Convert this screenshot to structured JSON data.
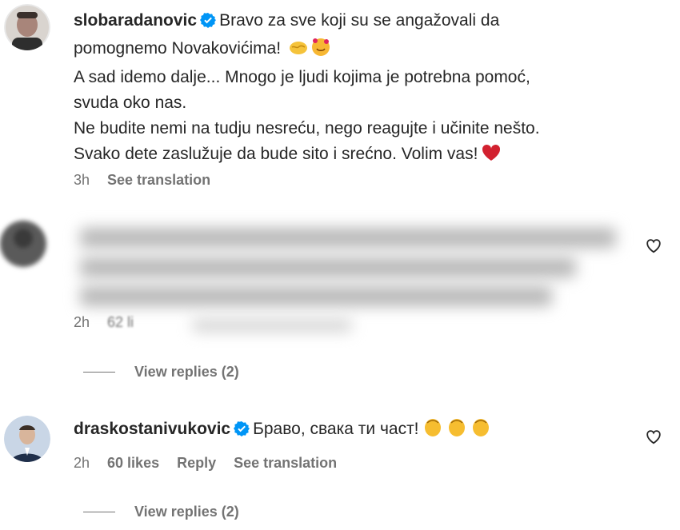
{
  "comments": [
    {
      "username": "slobaradanovic",
      "lines": [
        "Bravo za sve koji su se angažovali da",
        "pomognemo Novakovićima!",
        "A sad idemo dalje... Mnogo je ljudi kojima je potrebna pomoć,",
        "svuda oko nas.",
        "Ne budite nemi na tudju nesreću, nego reagujte i učinite nešto.",
        "Svako dete zaslužuje da bude sito i srećno. Volim vas!"
      ],
      "time": "3h",
      "see_translation": "See translation"
    },
    {
      "username": "",
      "time": "2h",
      "likes": "62 li",
      "view_replies": "View replies (2)"
    },
    {
      "username": "draskostanivukovic",
      "text": "Браво, свака ти част!",
      "time": "2h",
      "likes": "60 likes",
      "reply": "Reply",
      "see_translation": "See translation",
      "view_replies": "View replies (2)"
    }
  ],
  "colors": {
    "verified": "#0095f6",
    "heart_red": "#e0245e",
    "meta_gray": "#737373"
  }
}
